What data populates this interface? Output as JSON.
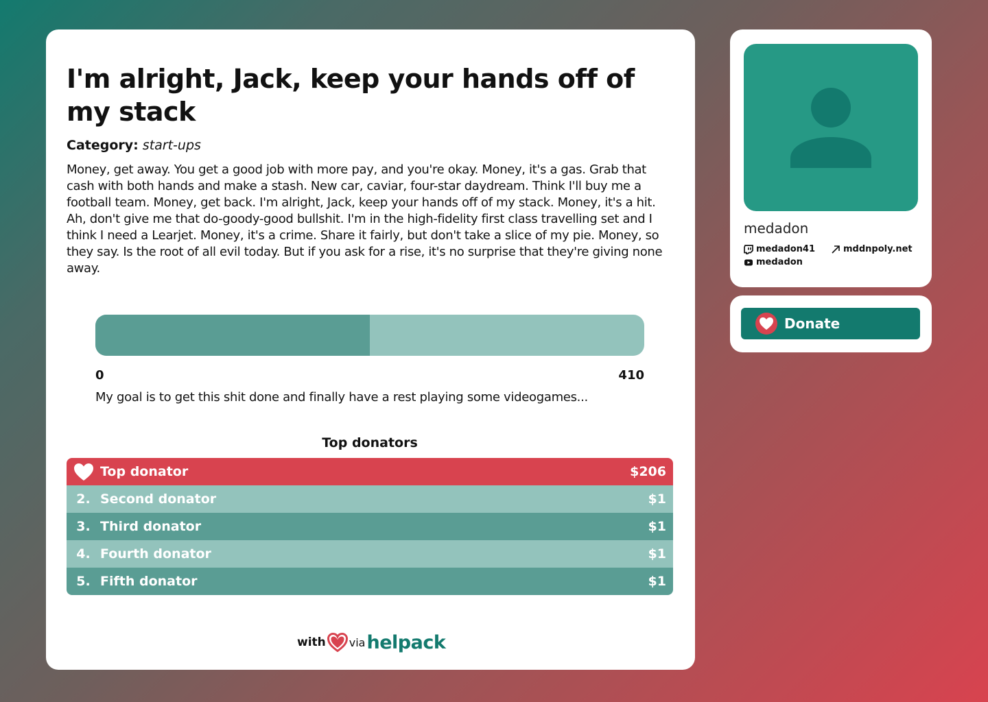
{
  "campaign": {
    "title": "I'm alright, Jack, keep your hands off of my stack",
    "category_label": "Category:",
    "category": "start-ups",
    "description": "Money, get away. You get a good job with more pay, and you're okay. Money, it's a gas. Grab that cash with both hands and make a stash. New car, caviar, four-star daydream. Think I'll buy me a football team. Money, get back. I'm alright, Jack, keep your hands off of my stack. Money, it's a hit. Ah, don't give me that do-goody-good bullshit. I'm in the high-fidelity first class travelling set and I think I need a Learjet. Money, it's a crime. Share it fairly, but don't take a slice of my pie. Money, so they say. Is the root of all evil today. But if you ask for a rise, it's no surprise that they're giving none away.",
    "progress": {
      "min": "0",
      "max": "410",
      "fraction": 0.5
    },
    "goal_text": "My goal is to get this shit done and finally have a rest playing some videogames..."
  },
  "donators": {
    "title": "Top donators",
    "top": {
      "name": "Top donator",
      "amount": "$206"
    },
    "rest": [
      {
        "rank": "2.",
        "name": "Second donator",
        "amount": "$1",
        "shade": "light"
      },
      {
        "rank": "3.",
        "name": "Third donator",
        "amount": "$1",
        "shade": "dark"
      },
      {
        "rank": "4.",
        "name": "Fourth donator",
        "amount": "$1",
        "shade": "light"
      },
      {
        "rank": "5.",
        "name": "Fifth donator",
        "amount": "$1",
        "shade": "dark"
      }
    ]
  },
  "branding": {
    "with": "with",
    "via": "via",
    "name": "helpack"
  },
  "profile": {
    "username": "medadon",
    "twitch": "medadon41",
    "website": "mddnpoly.net",
    "youtube": "medadon",
    "avatar_icon": "user-silhouette-icon"
  },
  "donate": {
    "label": "Donate"
  },
  "colors": {
    "accent": "#137a6e",
    "red": "#d8434f",
    "row_light": "#93c3bc",
    "row_dark": "#5a9d94",
    "avatar_bg": "#269985"
  }
}
